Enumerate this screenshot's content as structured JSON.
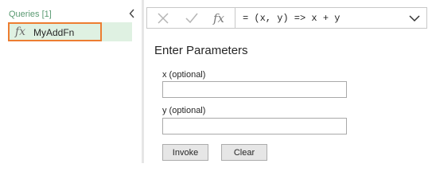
{
  "queries_pane": {
    "header": "Queries [1]",
    "items": [
      {
        "icon": "fx-function-icon",
        "icon_glyph": "fx",
        "label": "MyAddFn",
        "selected": true
      }
    ]
  },
  "formula_bar": {
    "fx_glyph": "fx",
    "formula": "= (x, y) => x + y"
  },
  "parameters": {
    "title": "Enter Parameters",
    "fields": [
      {
        "label": "x (optional)",
        "value": ""
      },
      {
        "label": "y (optional)",
        "value": ""
      }
    ],
    "invoke_label": "Invoke",
    "clear_label": "Clear"
  },
  "colors": {
    "selected_bg": "#dff1e2",
    "highlight_border": "#ed7d31",
    "header_text": "#5a9a72"
  }
}
